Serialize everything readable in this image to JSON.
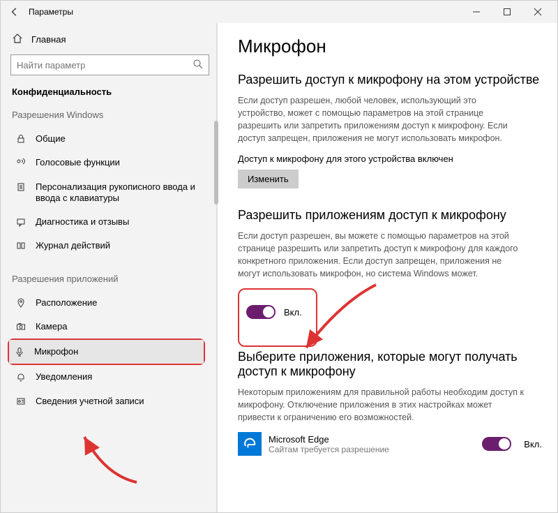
{
  "window": {
    "title": "Параметры"
  },
  "sidebar": {
    "home": "Главная",
    "search_placeholder": "Найти параметр",
    "category": "Конфиденциальность",
    "section_windows": "Разрешения Windows",
    "section_apps": "Разрешения приложений",
    "items_windows": [
      {
        "label": "Общие"
      },
      {
        "label": "Голосовые функции"
      },
      {
        "label": "Персонализация рукописного ввода и ввода с клавиатуры"
      },
      {
        "label": "Диагностика и отзывы"
      },
      {
        "label": "Журнал действий"
      }
    ],
    "items_apps": [
      {
        "label": "Расположение"
      },
      {
        "label": "Камера"
      },
      {
        "label": "Микрофон"
      },
      {
        "label": "Уведомления"
      },
      {
        "label": "Сведения учетной записи"
      }
    ]
  },
  "content": {
    "page_title": "Микрофон",
    "sec1_title": "Разрешить доступ к микрофону на этом устройстве",
    "sec1_desc": "Если доступ разрешен, любой человек, использующий это устройство, может с помощью параметров на этой странице разрешить или запретить приложениям доступ к микрофону. Если доступ запрещен, приложения не могут использовать микрофон.",
    "sec1_status": "Доступ к микрофону для этого устройства включен",
    "sec1_button": "Изменить",
    "sec2_title": "Разрешить приложениям доступ к микрофону",
    "sec2_desc": "Если доступ разрешен, вы можете с помощью параметров на этой странице разрешить или запретить доступ к микрофону для каждого конкретного приложения. Если доступ запрещен, приложения не могут использовать микрофон, но система Windows может.",
    "sec2_toggle_label": "Вкл.",
    "sec3_title": "Выберите приложения, которые могут получать доступ к микрофону",
    "sec3_desc": "Некоторым приложениям для правильной работы необходим доступ к микрофону. Отключение приложения в этих настройках может привести к ограничению его возможностей.",
    "app": {
      "name": "Microsoft Edge",
      "sub": "Сайтам требуется разрешение",
      "toggle": "Вкл."
    }
  }
}
